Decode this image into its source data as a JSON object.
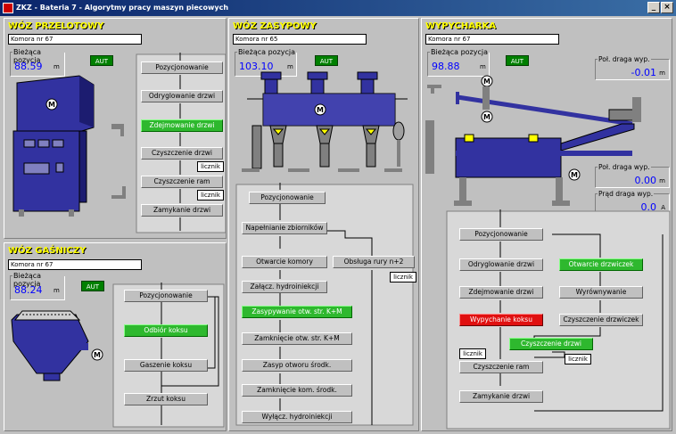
{
  "window": {
    "title": "ZKZ - Bateria 7 - Algorytmy pracy maszyn piecowych",
    "min": "_",
    "close": "×"
  },
  "icons": {
    "motor": "M"
  },
  "colors": {
    "title_yellow": "#ffff00",
    "value_blue": "#0000ff",
    "step_green": "#2eb82e",
    "step_red": "#e01010",
    "machine_blue": "#3232a0"
  },
  "woz_przelotowy": {
    "title": "WÓZ PRZELOTOWY",
    "chamber": "Komora nr 67",
    "pos_label": "Bieżąca pozycja",
    "pos_value": "88.59",
    "unit": "m",
    "mode": "AUT",
    "steps": [
      "Pozycjonowanie",
      "Odryglowanie drzwi",
      "Zdejmowanie drzwi",
      "Czyszczenie drzwi",
      "Czyszczenie ram",
      "Zamykanie drzwi"
    ],
    "counter1": "licznik",
    "counter2": "licznik"
  },
  "woz_gasniczy": {
    "title": "WÓZ GAŚNICZY",
    "chamber": "Komora nr 67",
    "pos_label": "Bieżąca pozycja",
    "pos_value": "88.24",
    "unit": "m",
    "mode": "AUT",
    "steps": [
      "Pozycjonowanie",
      "Odbiór koksu",
      "Gaszenie koksu",
      "Zrzut koksu"
    ]
  },
  "woz_zasypowy": {
    "title": "WÓZ ZASYPOWY",
    "chamber": "Komora nr 65",
    "pos_label": "Bieżąca pozycja",
    "pos_value": "103.10",
    "unit": "m",
    "mode": "AUT",
    "steps": [
      "Pozycjonowanie",
      "Napełnianie zbiorników",
      "Otwarcie komory",
      "Obsługa rury n+2",
      "Załącz. hydroiniekcji",
      "Zasypywanie otw. str. K+M",
      "Zamknięcie otw. str. K+M",
      "Zasyp otworu środk.",
      "Zamknięcie kom. środk.",
      "Wyłącz. hydroiniekcji"
    ],
    "counter": "licznik"
  },
  "wypycharka": {
    "title": "WYPYCHARKA",
    "chamber": "Komora nr 67",
    "pos_label": "Bieżąca pozycja",
    "pos_value": "98.88",
    "unit": "m",
    "mode": "AUT",
    "pol_draga1_label": "Poł. draga wyp.",
    "pol_draga1_value": "-0.01",
    "pol_draga2_label": "Poł. draga wyp.",
    "pol_draga2_value": "0.00",
    "prad_label": "Prąd draga wyp.",
    "prad_value": "0.0",
    "unit_a": "A",
    "steps": [
      "Pozycjonowanie",
      "Odryglowanie drzwi",
      "Otwarcie drzwiczek",
      "Zdejmowanie drzwi",
      "Wyrównywanie",
      "Wypychanie koksu",
      "Czyszczenie drzwiczek",
      "Czyszczenie drzwi",
      "Czyszczenie ram",
      "Zamykanie drzwi"
    ],
    "counter1": "licznik",
    "counter2": "licznik"
  }
}
